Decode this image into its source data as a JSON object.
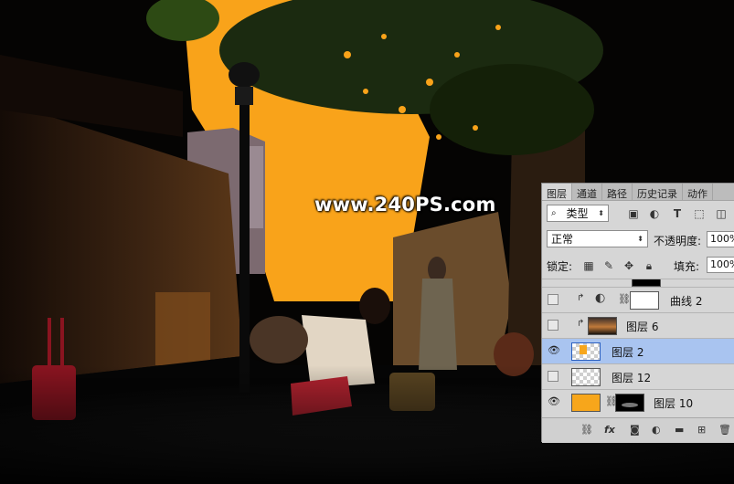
{
  "watermark": "www.240PS.com",
  "colors": {
    "sky_orange": "#f9a31a",
    "selected_row": "#a9c4f0",
    "panel_bg": "#d6d6d6",
    "fill_layer": "#f7a61b"
  },
  "panel": {
    "tabs": [
      "图层",
      "通道",
      "路径",
      "历史记录",
      "动作"
    ],
    "kind_filter": "类型",
    "blend_mode": "正常",
    "opacity_label": "不透明度:",
    "opacity_value": "100%",
    "lock_label": "锁定:",
    "fill_label": "填充:",
    "fill_value": "100%",
    "layers": [
      {
        "name": "曲线 2",
        "visible": false,
        "clipped": true,
        "thumb": "adjustment",
        "mask": "white",
        "selected": false
      },
      {
        "name": "图层 6",
        "visible": false,
        "clipped": true,
        "thumb": "photo",
        "mask": null,
        "selected": false
      },
      {
        "name": "图层 2",
        "visible": true,
        "clipped": false,
        "thumb": "transparent-orange",
        "mask": null,
        "selected": true
      },
      {
        "name": "图层 12",
        "visible": false,
        "clipped": false,
        "thumb": "transparent",
        "mask": null,
        "selected": false
      },
      {
        "name": "图层 10",
        "visible": true,
        "clipped": false,
        "thumb": "orange",
        "mask": "black",
        "selected": false
      }
    ],
    "icons": [
      "eye-icon",
      "link-icon",
      "fx-icon",
      "mask-icon",
      "adjustment-icon",
      "folder-icon",
      "new-layer-icon",
      "trash-icon"
    ]
  }
}
